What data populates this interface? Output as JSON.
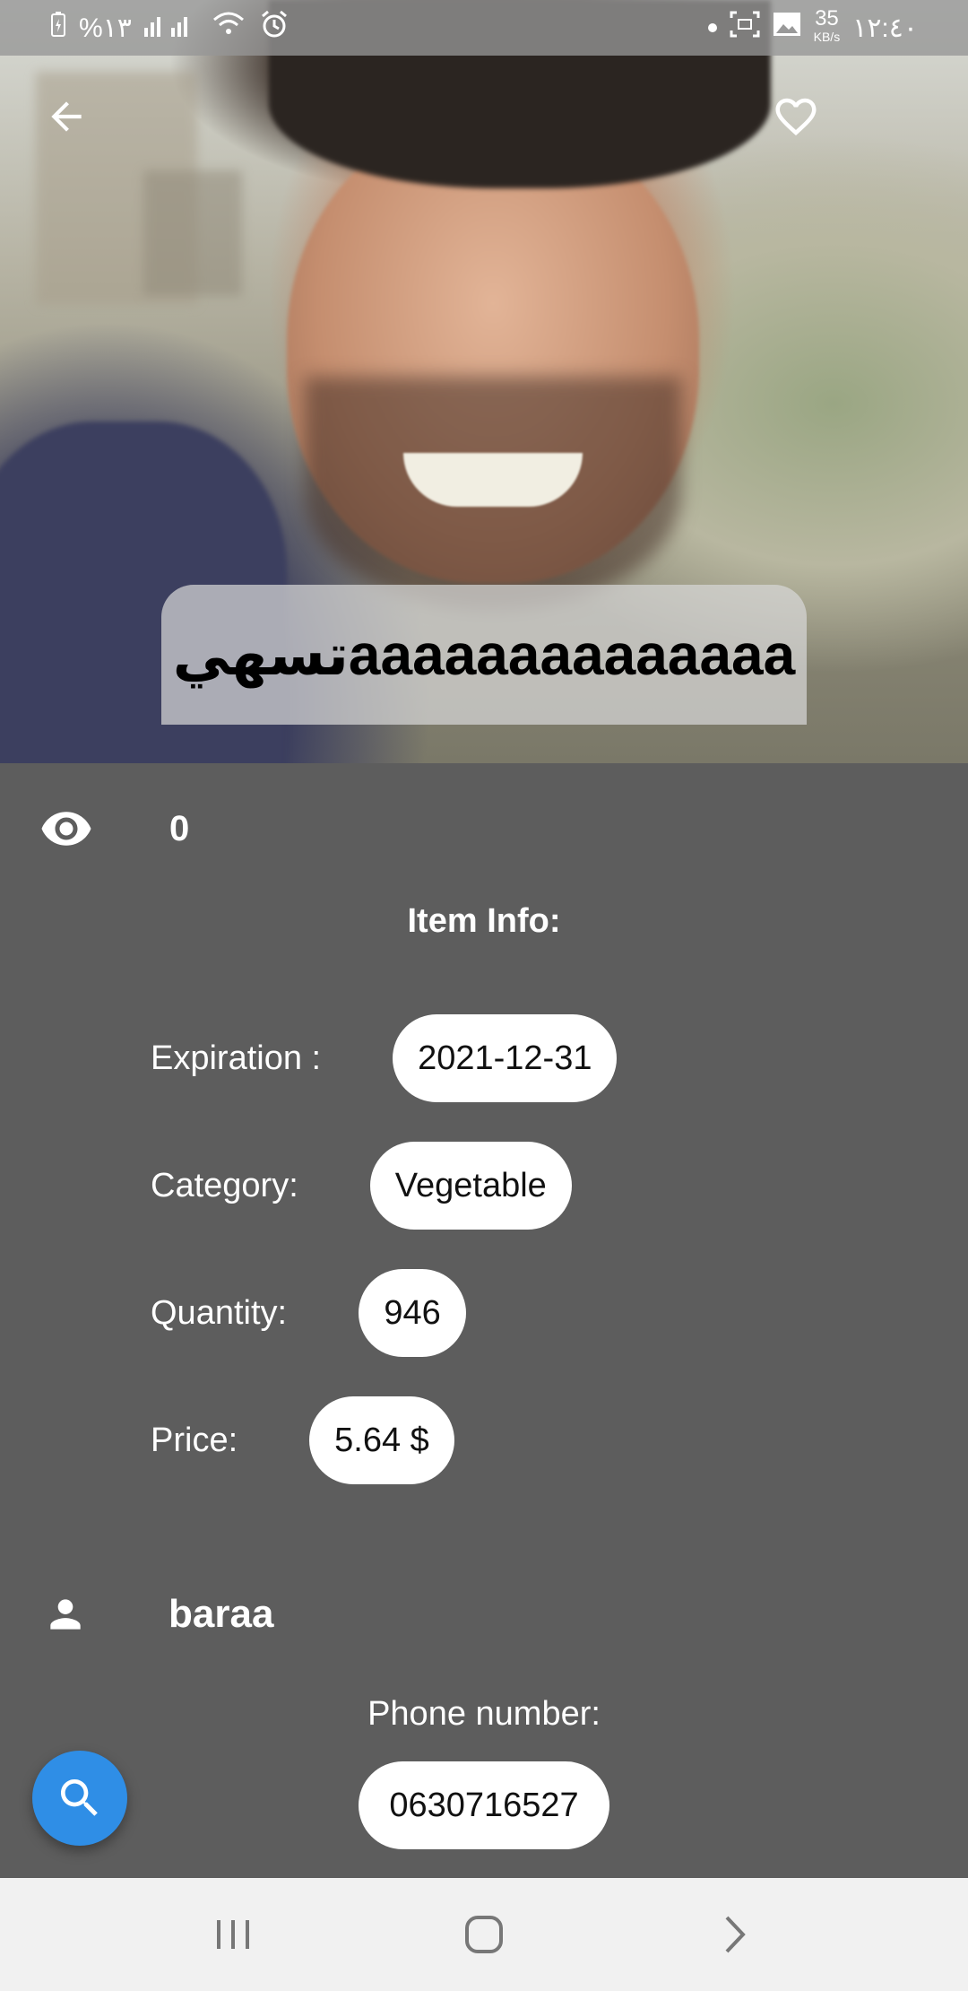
{
  "status_bar": {
    "battery": "%١٣",
    "time": "١٢:٤٠",
    "speed_value": "35",
    "speed_unit": "KB/s"
  },
  "icons": {
    "back": "arrow-back-icon",
    "favorite": "heart-outline-icon",
    "views": "eye-icon",
    "owner": "person-icon",
    "search": "search-icon"
  },
  "item": {
    "title": "تسهيaaaaaaaaaaaaaa",
    "views_count": "0"
  },
  "info": {
    "section_title": "Item Info:",
    "expiration_label": "Expiration :",
    "expiration_value": "2021-12-31",
    "category_label": "Category:",
    "category_value": "Vegetable",
    "quantity_label": "Quantity:",
    "quantity_value": "946",
    "price_label": "Price:",
    "price_value": "5.64 $"
  },
  "owner": {
    "name": "baraa",
    "phone_label": "Phone number:",
    "phone_value": "0630716527"
  },
  "colors": {
    "background": "#5d5d5d",
    "fab": "#2f8ee6",
    "pill": "#ffffff",
    "navbar": "#f1f1f1"
  }
}
